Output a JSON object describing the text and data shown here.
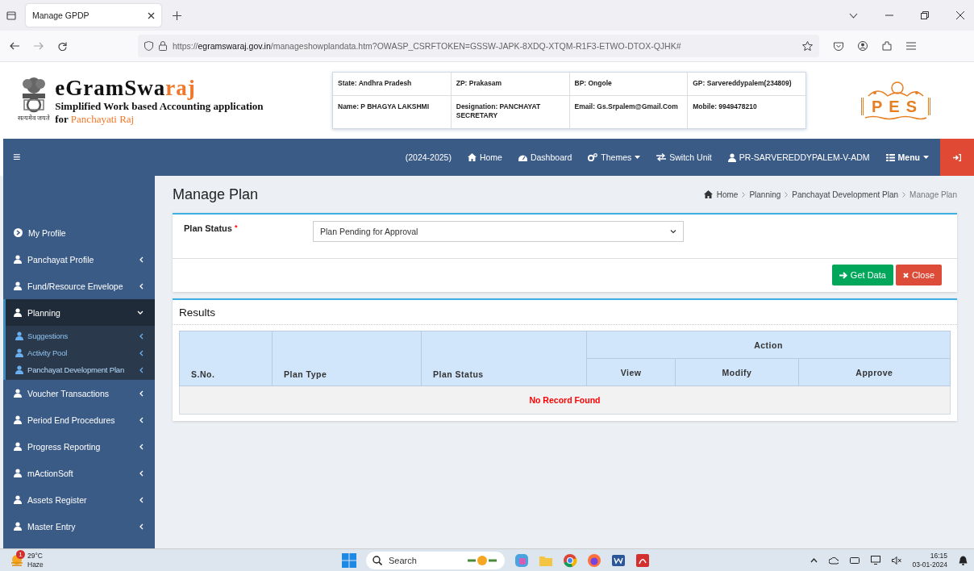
{
  "browser": {
    "tab_title": "Manage GPDP",
    "url_scheme": "https://",
    "url_host": "egramswaraj.gov.in",
    "url_path": "/manageshowplandata.htm?OWASP_CSRFTOKEN=GSSW-JAPK-8XDQ-XTQM-R1F3-ETWO-DTOX-QJHK#"
  },
  "header": {
    "brand_main": "eGramSwa",
    "brand_accent": "raj",
    "motto": "सत्यमेव जयते",
    "subtitle": "Simplified Work based Accounting application",
    "subtitle_prefix": "for",
    "subtitle_accent": "Panchayati Raj",
    "logo_text": "PES",
    "info_rows": [
      [
        "State: Andhra Pradesh",
        "ZP:  Prakasam",
        "BP:  Ongole",
        "GP:  Sarvereddypalem(234809)"
      ],
      [
        "Name: P BHAGYA LAKSHMI",
        "Designation: PANCHAYAT SECRETARY",
        "Email: Gs.Srpalem@Gmail.Com",
        "Mobile: 9949478210"
      ]
    ]
  },
  "navbar": {
    "menu_glyph": "≡",
    "items": [
      {
        "kind": "text",
        "label": "(2024-2025)",
        "caret": false
      },
      {
        "kind": "home",
        "label": "Home",
        "caret": false
      },
      {
        "kind": "dashboard",
        "label": "Dashboard",
        "caret": false
      },
      {
        "kind": "gears",
        "label": "Themes",
        "caret": true
      },
      {
        "kind": "switch",
        "label": "Switch Unit",
        "caret": false
      },
      {
        "kind": "user",
        "label": "PR-SARVEREDDYPALEM-V-ADM",
        "caret": false
      },
      {
        "kind": "grid",
        "label": "Menu",
        "caret": true
      }
    ]
  },
  "sidebar": {
    "items": [
      {
        "kind": "circle",
        "label": "My Profile"
      },
      {
        "kind": "user",
        "label": "Panchayat Profile",
        "expanded": false
      },
      {
        "kind": "user",
        "label": "Fund/Resource Envelope",
        "expanded": false
      },
      {
        "kind": "user",
        "label": "Planning",
        "expanded": true,
        "children": [
          {
            "label": "Suggestions",
            "selected": false
          },
          {
            "label": "Activity Pool",
            "selected": false
          },
          {
            "label": "Panchayat Development Plan",
            "selected": true
          }
        ]
      },
      {
        "kind": "user",
        "label": "Voucher Transactions",
        "expanded": false
      },
      {
        "kind": "user",
        "label": "Period End Procedures",
        "expanded": false
      },
      {
        "kind": "user",
        "label": "Progress Reporting",
        "expanded": false
      },
      {
        "kind": "user",
        "label": "mActionSoft",
        "expanded": false
      },
      {
        "kind": "user",
        "label": "Assets Register",
        "expanded": false
      },
      {
        "kind": "user",
        "label": "Master Entry",
        "expanded": false
      }
    ]
  },
  "page": {
    "title": "Manage Plan",
    "breadcrumb": [
      "Home",
      "Planning",
      "Panchayat Development Plan",
      "Manage Plan"
    ]
  },
  "form": {
    "label": "Plan Status",
    "required_mark": "*",
    "value": "Plan Pending for Approval",
    "buttons": [
      {
        "kind": "success",
        "label": "Get Data"
      },
      {
        "kind": "danger",
        "label": "Close"
      }
    ]
  },
  "results": {
    "title": "Results",
    "columns": [
      "S.No.",
      "Plan Type",
      "Plan Status"
    ],
    "group": "Action",
    "subcolumns": [
      "View",
      "Modify",
      "Approve"
    ],
    "empty": "No Record Found"
  },
  "taskbar": {
    "temperature": "29°C",
    "weather": "Haze",
    "badge": "1",
    "search": "Search",
    "time": "16:15",
    "date": "03-01-2024"
  }
}
